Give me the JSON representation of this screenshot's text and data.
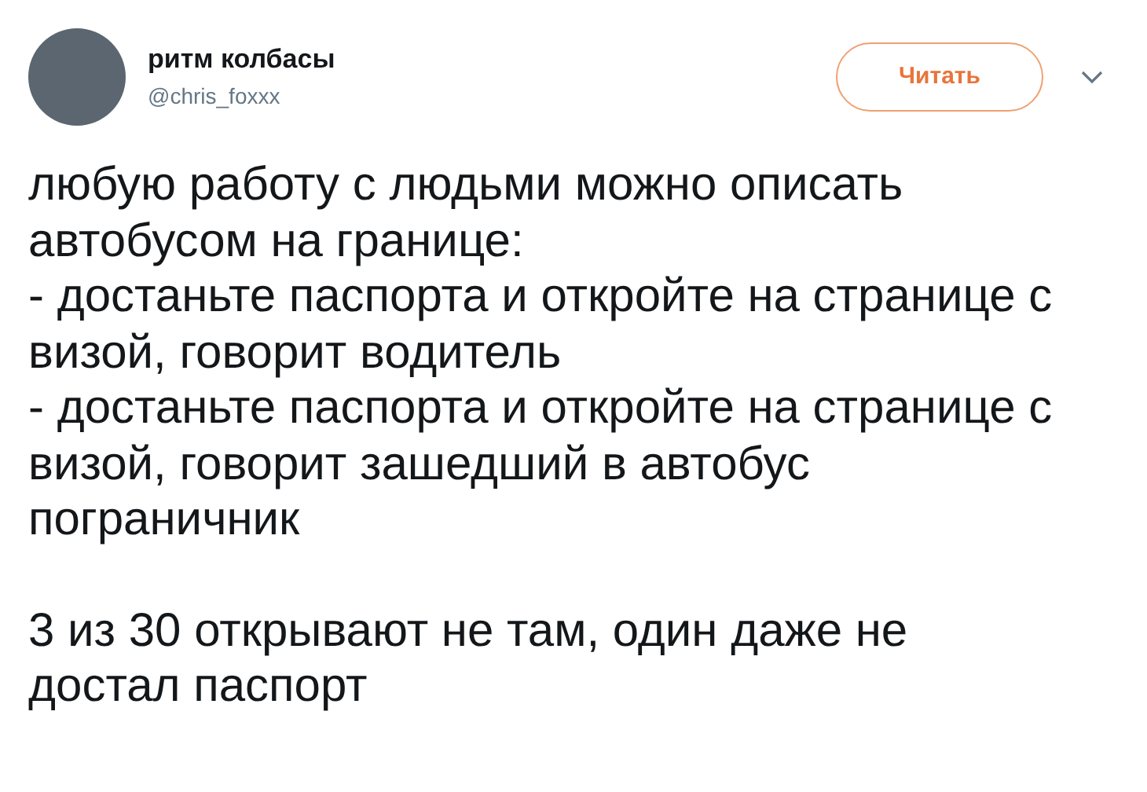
{
  "author": {
    "name": "ритм колбасы",
    "handle": "@chris_foxxx"
  },
  "follow_button": {
    "label": "Читать"
  },
  "tweet": {
    "sections": [
      {
        "paragraphs": [
          "любую работу с людьми можно описать автобусом на границе:",
          "- достаньте паспорта и откройте на странице с визой, говорит водитель",
          "- достаньте паспорта и откройте на странице с визой, говорит зашедший в автобус пограничник"
        ]
      },
      {
        "paragraphs": [
          "3 из 30 открывают не там, один даже не достал паспорт"
        ]
      }
    ]
  }
}
